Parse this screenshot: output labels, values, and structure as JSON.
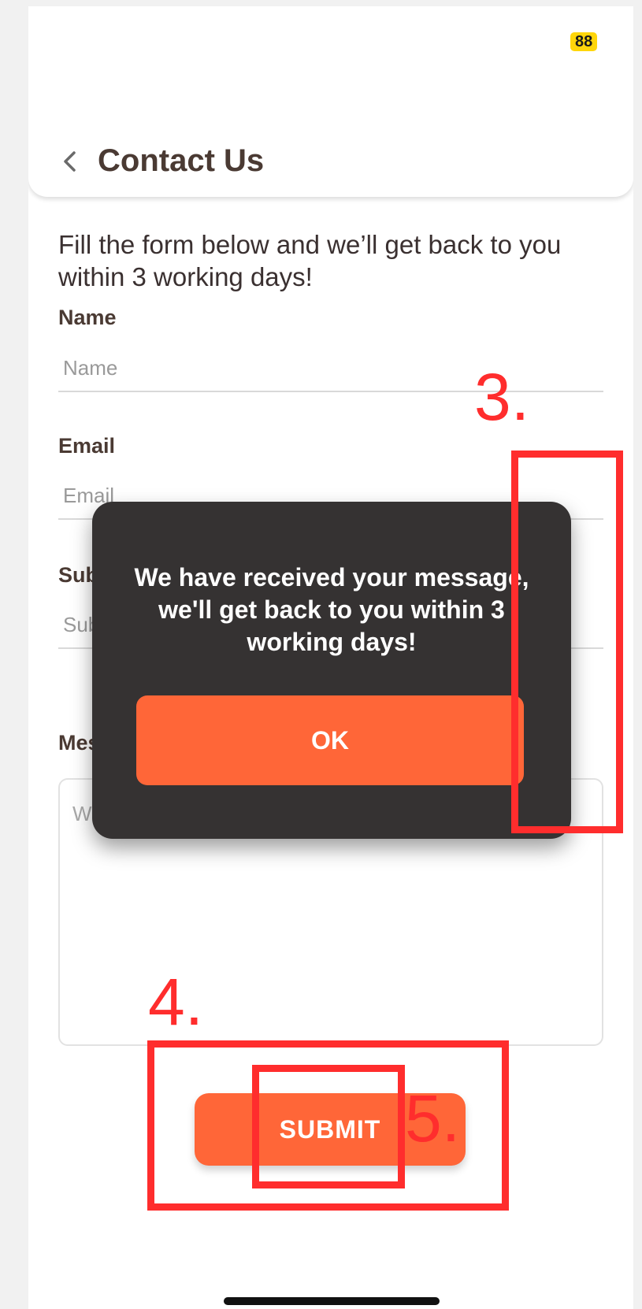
{
  "status_bar": {
    "battery": "88"
  },
  "header": {
    "title": "Contact Us"
  },
  "intro_text": "Fill the form below and we’ll get back to you within 3 working days!",
  "form": {
    "name_label": "Name",
    "name_placeholder": "Name",
    "email_label": "Email",
    "email_placeholder": "Email",
    "subject_label": "Subject",
    "subject_placeholder": "Subject",
    "message_label": "Message",
    "message_placeholder": "What's your issue",
    "submit_label": "SUBMIT"
  },
  "dialog": {
    "message": "We have received your message, we'll get back to you within 3 working days!",
    "ok_label": "OK"
  },
  "annotations": [
    "3.",
    "4.",
    "5."
  ],
  "colors": {
    "accent": "#ff6638",
    "dialog_bg": "#353232",
    "annotation": "#ff2d2d",
    "title": "#4a3a33",
    "battery": "#ffd60a"
  }
}
